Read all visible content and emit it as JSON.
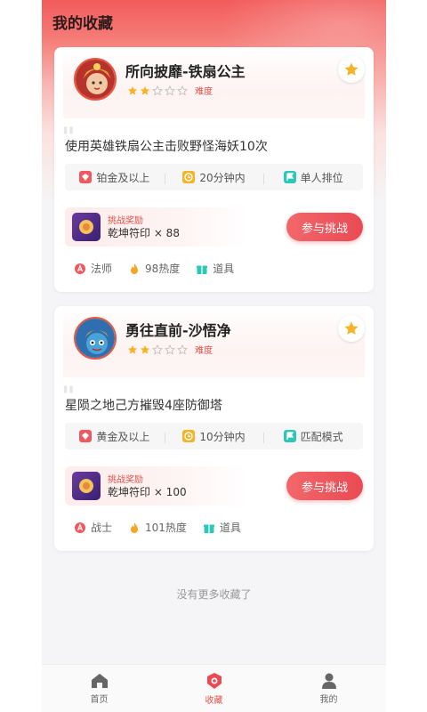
{
  "page": {
    "title": "我的收藏"
  },
  "cards": [
    {
      "hero_name": "所向披靡-铁扇公主",
      "rating": 2,
      "rating_max": 5,
      "difficulty": "难度",
      "description": "使用英雄铁扇公主击败野怪海妖10次",
      "tags": [
        {
          "icon": "rank-icon",
          "color": "#f0585f",
          "label": "铂金及以上"
        },
        {
          "icon": "clock-icon",
          "color": "#f5b325",
          "label": "20分钟内"
        },
        {
          "icon": "flag-icon",
          "color": "#2cc7b5",
          "label": "单人排位"
        }
      ],
      "reward_label": "挑战奖励",
      "reward_value": "乾坤符印 × 88",
      "join_label": "参与挑战",
      "meta": [
        {
          "icon": "role-icon",
          "color": "#f0585f",
          "label": "法师"
        },
        {
          "icon": "fire-icon",
          "color": "#f5a623",
          "label": "98热度"
        },
        {
          "icon": "gift-icon",
          "color": "#2cc7b5",
          "label": "道具"
        }
      ]
    },
    {
      "hero_name": "勇往直前-沙悟净",
      "rating": 2,
      "rating_max": 5,
      "difficulty": "难度",
      "description": "星陨之地己方摧毁4座防御塔",
      "tags": [
        {
          "icon": "rank-icon",
          "color": "#f0585f",
          "label": "黄金及以上"
        },
        {
          "icon": "clock-icon",
          "color": "#f5b325",
          "label": "10分钟内"
        },
        {
          "icon": "flag-icon",
          "color": "#2cc7b5",
          "label": "匹配模式"
        }
      ],
      "reward_label": "挑战奖励",
      "reward_value": "乾坤符印 × 100",
      "join_label": "参与挑战",
      "meta": [
        {
          "icon": "role-icon",
          "color": "#f0585f",
          "label": "战士"
        },
        {
          "icon": "fire-icon",
          "color": "#f5a623",
          "label": "101热度"
        },
        {
          "icon": "gift-icon",
          "color": "#2cc7b5",
          "label": "道具"
        }
      ]
    }
  ],
  "footer_note": "没有更多收藏了",
  "tabbar": [
    {
      "icon": "home-icon",
      "label": "首页",
      "active": false
    },
    {
      "icon": "favorites-icon",
      "label": "收藏",
      "active": true
    },
    {
      "icon": "profile-icon",
      "label": "我的",
      "active": false
    }
  ],
  "colors": {
    "accent": "#e94a53",
    "star": "#f5b325"
  }
}
